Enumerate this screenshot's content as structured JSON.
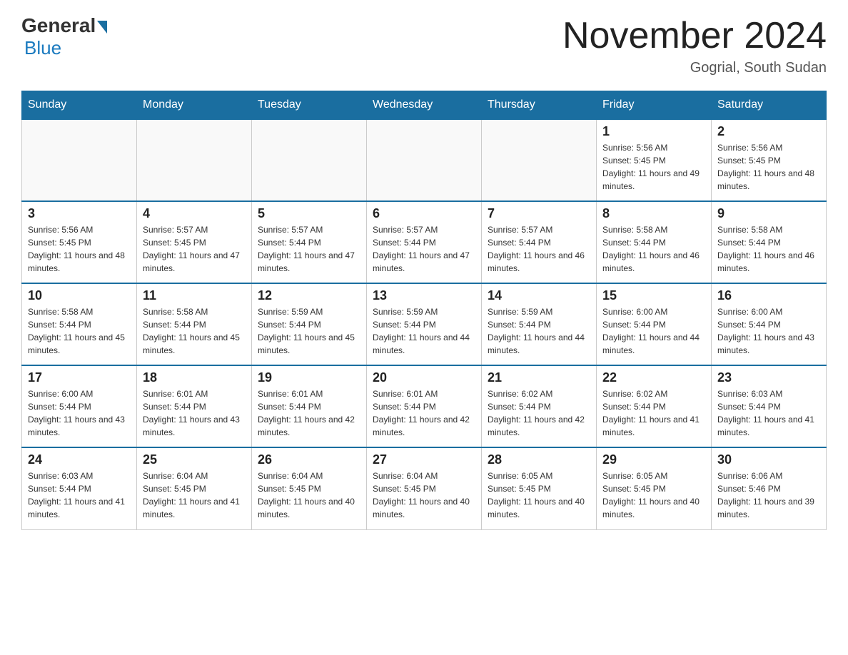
{
  "header": {
    "logo_general": "General",
    "logo_blue": "Blue",
    "month_title": "November 2024",
    "location": "Gogrial, South Sudan"
  },
  "weekdays": [
    "Sunday",
    "Monday",
    "Tuesday",
    "Wednesday",
    "Thursday",
    "Friday",
    "Saturday"
  ],
  "weeks": [
    [
      {
        "day": "",
        "sunrise": "",
        "sunset": "",
        "daylight": ""
      },
      {
        "day": "",
        "sunrise": "",
        "sunset": "",
        "daylight": ""
      },
      {
        "day": "",
        "sunrise": "",
        "sunset": "",
        "daylight": ""
      },
      {
        "day": "",
        "sunrise": "",
        "sunset": "",
        "daylight": ""
      },
      {
        "day": "",
        "sunrise": "",
        "sunset": "",
        "daylight": ""
      },
      {
        "day": "1",
        "sunrise": "Sunrise: 5:56 AM",
        "sunset": "Sunset: 5:45 PM",
        "daylight": "Daylight: 11 hours and 49 minutes."
      },
      {
        "day": "2",
        "sunrise": "Sunrise: 5:56 AM",
        "sunset": "Sunset: 5:45 PM",
        "daylight": "Daylight: 11 hours and 48 minutes."
      }
    ],
    [
      {
        "day": "3",
        "sunrise": "Sunrise: 5:56 AM",
        "sunset": "Sunset: 5:45 PM",
        "daylight": "Daylight: 11 hours and 48 minutes."
      },
      {
        "day": "4",
        "sunrise": "Sunrise: 5:57 AM",
        "sunset": "Sunset: 5:45 PM",
        "daylight": "Daylight: 11 hours and 47 minutes."
      },
      {
        "day": "5",
        "sunrise": "Sunrise: 5:57 AM",
        "sunset": "Sunset: 5:44 PM",
        "daylight": "Daylight: 11 hours and 47 minutes."
      },
      {
        "day": "6",
        "sunrise": "Sunrise: 5:57 AM",
        "sunset": "Sunset: 5:44 PM",
        "daylight": "Daylight: 11 hours and 47 minutes."
      },
      {
        "day": "7",
        "sunrise": "Sunrise: 5:57 AM",
        "sunset": "Sunset: 5:44 PM",
        "daylight": "Daylight: 11 hours and 46 minutes."
      },
      {
        "day": "8",
        "sunrise": "Sunrise: 5:58 AM",
        "sunset": "Sunset: 5:44 PM",
        "daylight": "Daylight: 11 hours and 46 minutes."
      },
      {
        "day": "9",
        "sunrise": "Sunrise: 5:58 AM",
        "sunset": "Sunset: 5:44 PM",
        "daylight": "Daylight: 11 hours and 46 minutes."
      }
    ],
    [
      {
        "day": "10",
        "sunrise": "Sunrise: 5:58 AM",
        "sunset": "Sunset: 5:44 PM",
        "daylight": "Daylight: 11 hours and 45 minutes."
      },
      {
        "day": "11",
        "sunrise": "Sunrise: 5:58 AM",
        "sunset": "Sunset: 5:44 PM",
        "daylight": "Daylight: 11 hours and 45 minutes."
      },
      {
        "day": "12",
        "sunrise": "Sunrise: 5:59 AM",
        "sunset": "Sunset: 5:44 PM",
        "daylight": "Daylight: 11 hours and 45 minutes."
      },
      {
        "day": "13",
        "sunrise": "Sunrise: 5:59 AM",
        "sunset": "Sunset: 5:44 PM",
        "daylight": "Daylight: 11 hours and 44 minutes."
      },
      {
        "day": "14",
        "sunrise": "Sunrise: 5:59 AM",
        "sunset": "Sunset: 5:44 PM",
        "daylight": "Daylight: 11 hours and 44 minutes."
      },
      {
        "day": "15",
        "sunrise": "Sunrise: 6:00 AM",
        "sunset": "Sunset: 5:44 PM",
        "daylight": "Daylight: 11 hours and 44 minutes."
      },
      {
        "day": "16",
        "sunrise": "Sunrise: 6:00 AM",
        "sunset": "Sunset: 5:44 PM",
        "daylight": "Daylight: 11 hours and 43 minutes."
      }
    ],
    [
      {
        "day": "17",
        "sunrise": "Sunrise: 6:00 AM",
        "sunset": "Sunset: 5:44 PM",
        "daylight": "Daylight: 11 hours and 43 minutes."
      },
      {
        "day": "18",
        "sunrise": "Sunrise: 6:01 AM",
        "sunset": "Sunset: 5:44 PM",
        "daylight": "Daylight: 11 hours and 43 minutes."
      },
      {
        "day": "19",
        "sunrise": "Sunrise: 6:01 AM",
        "sunset": "Sunset: 5:44 PM",
        "daylight": "Daylight: 11 hours and 42 minutes."
      },
      {
        "day": "20",
        "sunrise": "Sunrise: 6:01 AM",
        "sunset": "Sunset: 5:44 PM",
        "daylight": "Daylight: 11 hours and 42 minutes."
      },
      {
        "day": "21",
        "sunrise": "Sunrise: 6:02 AM",
        "sunset": "Sunset: 5:44 PM",
        "daylight": "Daylight: 11 hours and 42 minutes."
      },
      {
        "day": "22",
        "sunrise": "Sunrise: 6:02 AM",
        "sunset": "Sunset: 5:44 PM",
        "daylight": "Daylight: 11 hours and 41 minutes."
      },
      {
        "day": "23",
        "sunrise": "Sunrise: 6:03 AM",
        "sunset": "Sunset: 5:44 PM",
        "daylight": "Daylight: 11 hours and 41 minutes."
      }
    ],
    [
      {
        "day": "24",
        "sunrise": "Sunrise: 6:03 AM",
        "sunset": "Sunset: 5:44 PM",
        "daylight": "Daylight: 11 hours and 41 minutes."
      },
      {
        "day": "25",
        "sunrise": "Sunrise: 6:04 AM",
        "sunset": "Sunset: 5:45 PM",
        "daylight": "Daylight: 11 hours and 41 minutes."
      },
      {
        "day": "26",
        "sunrise": "Sunrise: 6:04 AM",
        "sunset": "Sunset: 5:45 PM",
        "daylight": "Daylight: 11 hours and 40 minutes."
      },
      {
        "day": "27",
        "sunrise": "Sunrise: 6:04 AM",
        "sunset": "Sunset: 5:45 PM",
        "daylight": "Daylight: 11 hours and 40 minutes."
      },
      {
        "day": "28",
        "sunrise": "Sunrise: 6:05 AM",
        "sunset": "Sunset: 5:45 PM",
        "daylight": "Daylight: 11 hours and 40 minutes."
      },
      {
        "day": "29",
        "sunrise": "Sunrise: 6:05 AM",
        "sunset": "Sunset: 5:45 PM",
        "daylight": "Daylight: 11 hours and 40 minutes."
      },
      {
        "day": "30",
        "sunrise": "Sunrise: 6:06 AM",
        "sunset": "Sunset: 5:46 PM",
        "daylight": "Daylight: 11 hours and 39 minutes."
      }
    ]
  ]
}
